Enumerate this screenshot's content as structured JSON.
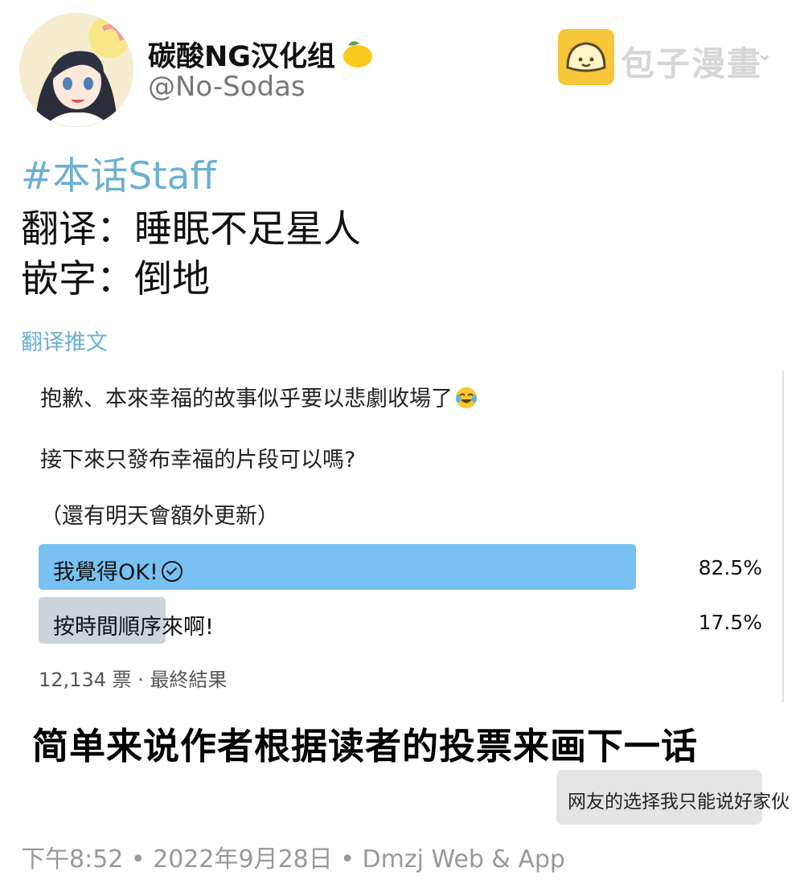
{
  "header": {
    "display_name": "碳酸NG汉化组",
    "handle": "@No-Sodas",
    "name_emoji": "lemon-icon"
  },
  "watermark": {
    "text": "包子漫畫",
    "logo_color": "#f7c73a"
  },
  "credits": {
    "hashtag": "#本话Staff",
    "lines": [
      "翻译：睡眠不足星人",
      "嵌字：倒地"
    ]
  },
  "translate_link": "翻译推文",
  "quoted_tweet": {
    "lines": [
      "抱歉、本來幸福的故事似乎要以悲劇收場了",
      "接下來只發布幸福的片段可以嗎?",
      "（還有明天會額外更新）"
    ],
    "emoji": "crying-laughing-icon",
    "poll": {
      "options": [
        {
          "label": "我覺得OK!",
          "percent": "82.5%",
          "fraction": 0.825,
          "selected": true
        },
        {
          "label": "按時間順序來啊!",
          "percent": "17.5%",
          "fraction": 0.175,
          "selected": false
        }
      ],
      "footer": "12,134 票 · 最終結果",
      "colors": {
        "winner": "#78c1f3",
        "other": "#ccd4da"
      }
    }
  },
  "summary": "简单来说作者根据读者的投票来画下一话",
  "bubble": "网友的选择我只能说好家伙",
  "meta": "下午8:52 • 2022年9月28日 • Dmzj Web & App",
  "accent_color": "#6cb0d4"
}
